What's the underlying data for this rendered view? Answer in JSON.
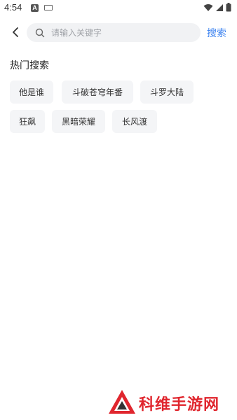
{
  "status_bar": {
    "time": "4:54",
    "left_icons": [
      "a-notification-icon",
      "keyboard-icon"
    ],
    "right_icons": [
      "wifi-icon",
      "signal-icon",
      "battery-icon"
    ]
  },
  "search": {
    "placeholder": "请输入关键字",
    "value": "",
    "button_label": "搜索"
  },
  "hot_search": {
    "title": "热门搜索",
    "tags": [
      "他是谁",
      "斗破苍穹年番",
      "斗罗大陆",
      "狂飙",
      "黑暗荣耀",
      "长风渡"
    ]
  },
  "watermark": {
    "text": "科维手游网"
  },
  "colors": {
    "accent": "#3b82f0",
    "tag_bg": "#f4f5f7",
    "search_bg": "#f1f2f4",
    "watermark_red": "#e0262e"
  }
}
